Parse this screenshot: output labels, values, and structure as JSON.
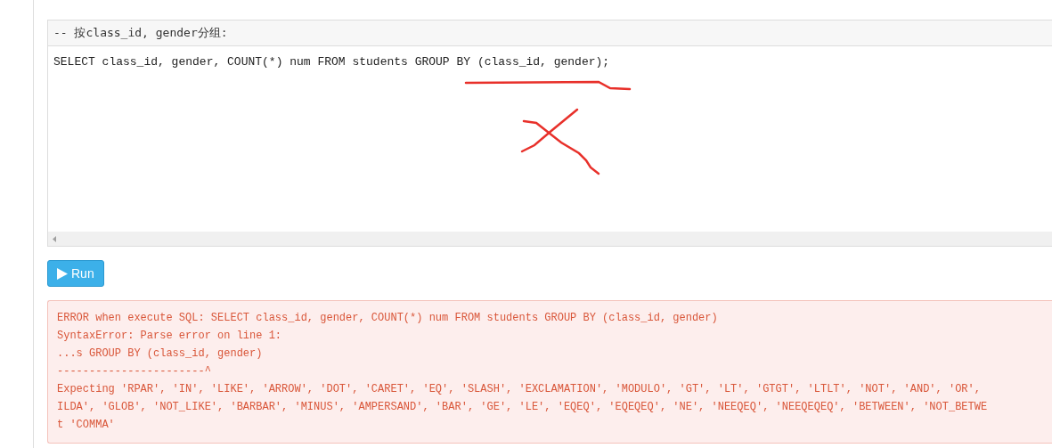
{
  "editor": {
    "header": "-- 按class_id, gender分组:",
    "code": "SELECT class_id, gender, COUNT(*) num FROM students GROUP BY (class_id, gender);"
  },
  "run_button": {
    "label": "Run"
  },
  "error": {
    "lines": [
      "ERROR when execute SQL: SELECT class_id, gender, COUNT(*) num FROM students GROUP BY (class_id, gender)",
      "SyntaxError: Parse error on line 1:",
      "...s GROUP BY (class_id, gender)",
      "-----------------------^",
      "Expecting 'RPAR', 'IN', 'LIKE', 'ARROW', 'DOT', 'CARET', 'EQ', 'SLASH', 'EXCLAMATION', 'MODULO', 'GT', 'LT', 'GTGT', 'LTLT', 'NOT', 'AND', 'OR',",
      "ILDA', 'GLOB', 'NOT_LIKE', 'BARBAR', 'MINUS', 'AMPERSAND', 'BAR', 'GE', 'LE', 'EQEQ', 'EQEQEQ', 'NE', 'NEEQEQ', 'NEEQEQEQ', 'BETWEEN', 'NOT_BETWE",
      "t 'COMMA'"
    ]
  }
}
